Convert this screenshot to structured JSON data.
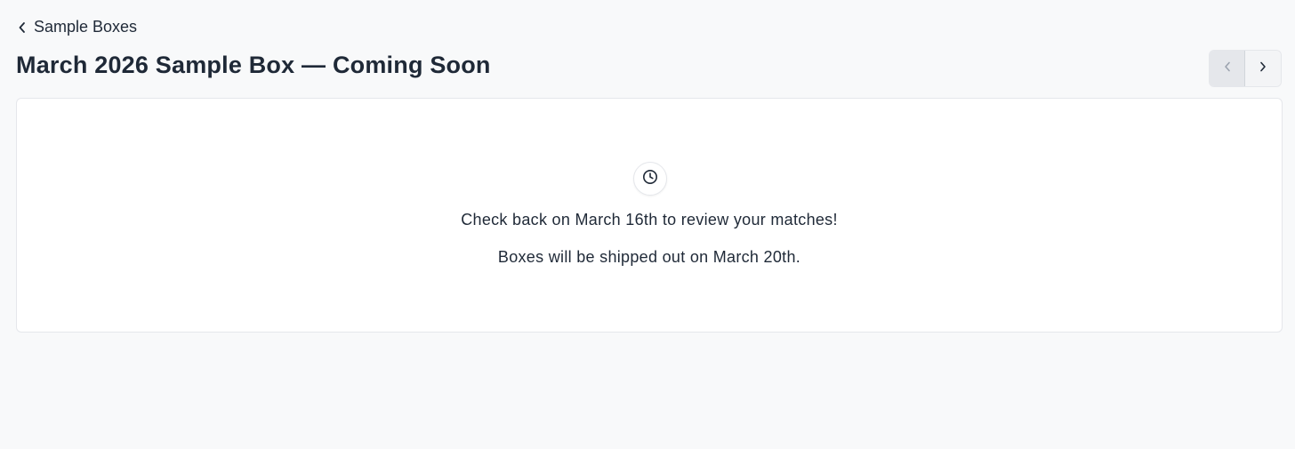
{
  "header": {
    "back_label": "Sample Boxes",
    "title": "March 2026 Sample Box — Coming Soon"
  },
  "pager": {
    "prev_icon": "chevron-left-icon",
    "next_icon": "chevron-right-icon"
  },
  "card": {
    "icon": "clock-icon",
    "line1": "Check back on March 16th to review your matches!",
    "line2": "Boxes will be shipped out on March 20th."
  },
  "colors": {
    "background": "#f8f9fa",
    "card_background": "#ffffff",
    "border": "#e5e7eb",
    "text": "#1f2937"
  }
}
